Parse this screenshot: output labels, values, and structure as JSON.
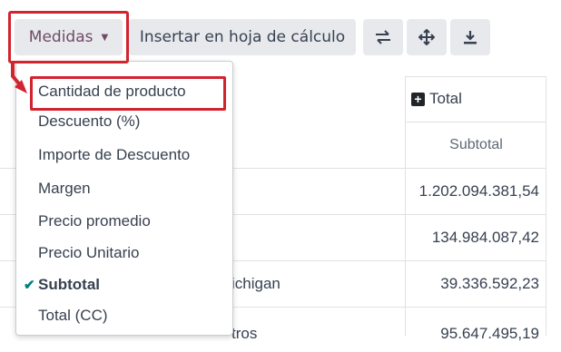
{
  "toolbar": {
    "measures_label": "Medidas",
    "insert_label": "Insertar en hoja de cálculo",
    "icons": [
      "flip-axis-icon",
      "expand-all-icon",
      "download-icon"
    ]
  },
  "measures_menu": {
    "items": [
      {
        "label": "Cantidad de producto",
        "selected": false
      },
      {
        "label": "Descuento (%)",
        "selected": false
      },
      {
        "label": "Importe de Descuento",
        "selected": false
      },
      {
        "label": "Margen",
        "selected": false
      },
      {
        "label": "Precio promedio",
        "selected": false
      },
      {
        "label": "Precio Unitario",
        "selected": false
      },
      {
        "label": "Subtotal",
        "selected": true
      },
      {
        "label": "Total (CC)",
        "selected": false
      }
    ],
    "check_mark": "✔"
  },
  "table": {
    "header_total": "Total",
    "header_measure": "Subtotal",
    "rows": [
      {
        "label": "",
        "value": "1.202.094.381,54"
      },
      {
        "label": "",
        "value": "134.984.087,42"
      },
      {
        "label": "ichigan",
        "value": "39.336.592,23"
      },
      {
        "label": "tros",
        "value": "95.647.495,19"
      }
    ]
  },
  "colors": {
    "accent": "#714b67",
    "highlight": "#d1242f",
    "check": "#017e84",
    "button_bg": "#e7e9ed"
  }
}
